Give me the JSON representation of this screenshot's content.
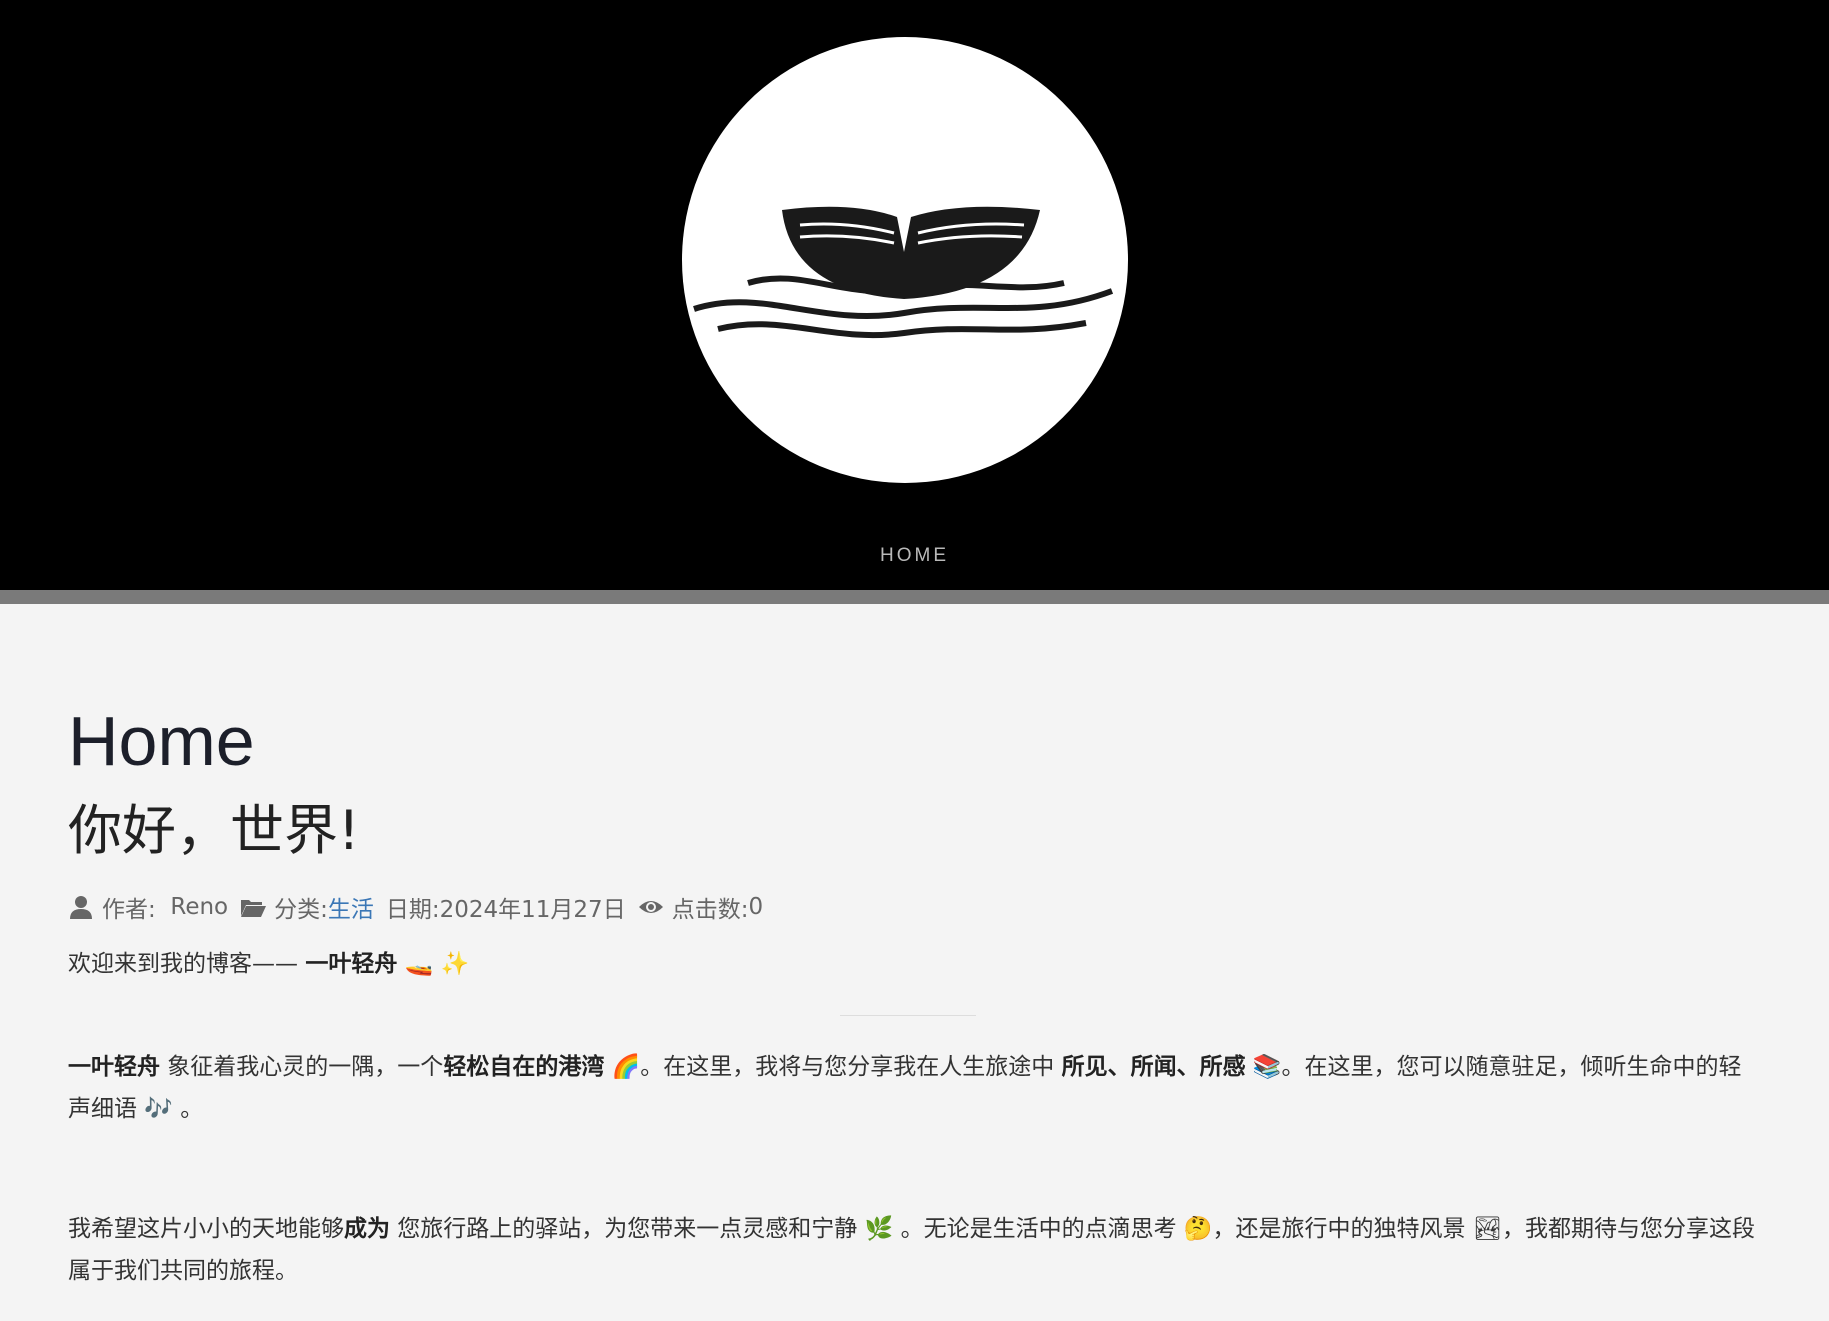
{
  "nav": {
    "home_label": "HOME"
  },
  "page": {
    "title": "Home"
  },
  "post": {
    "title": "你好，世界!",
    "meta": {
      "author_label": "作者:",
      "author": "Reno",
      "category_label": "分类:",
      "category": "生活",
      "date_label": "日期:",
      "date": "2024年11月27日",
      "views_label": "点击数:",
      "views": "0"
    },
    "intro": {
      "text": "欢迎来到我的博客—— ",
      "bold": "一叶轻舟",
      "emojis": "🚤 ✨"
    },
    "para1": {
      "b1": "一叶轻舟",
      "t1": " 象征着我心灵的一隅，一个",
      "b2": "轻松自在的港湾",
      "e1": " 🌈",
      "t2": "。在这里，我将与您分享我在人生旅途中 ",
      "b3": "所见、所闻、所感",
      "e2": " 📚",
      "t3": "。在这里，您可以随意驻足，倾听生命中的轻声细语 ",
      "e3": "🎶",
      "t4": " 。"
    },
    "para2": {
      "t1": "我希望这片小小的天地能够",
      "b1": "成为",
      "t2": " 您旅行路上的驿站，为您带来一点灵感和宁静 ",
      "e1": "🌿",
      "t3": " 。无论是生活中的点滴思考 ",
      "e2": "🤔",
      "t4": "，还是旅行中的独特风景 ",
      "e3": "🏞",
      "t5": "，我都期待与您分享这段属于我们共同的旅程。"
    }
  },
  "colors": {
    "header_bg": "#000000",
    "link": "#3b77b6",
    "page_bg": "#f4f4f4"
  },
  "icons": [
    "user-icon",
    "folder-icon",
    "eye-icon",
    "boat-logo"
  ]
}
